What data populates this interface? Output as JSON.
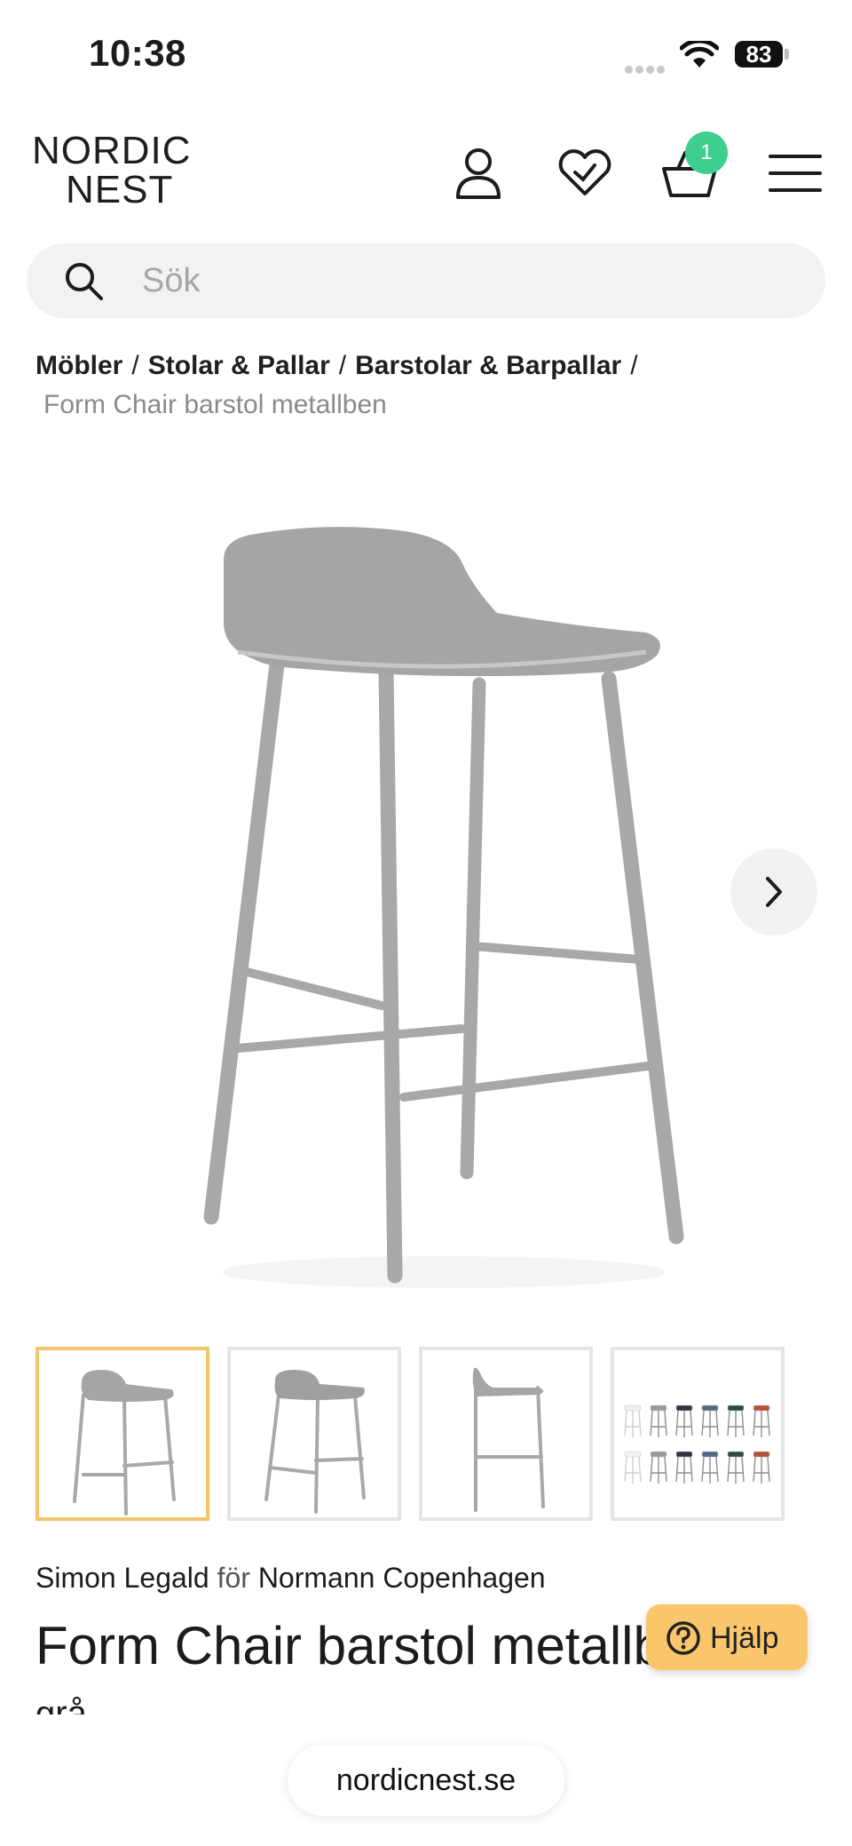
{
  "status_bar": {
    "time": "10:38",
    "battery": "83"
  },
  "header": {
    "logo_line1": "NORDIC",
    "logo_line2": "NEST",
    "cart_count": "1",
    "icons": [
      "account-icon",
      "wishlist-heart-icon",
      "basket-icon",
      "menu-icon"
    ]
  },
  "search": {
    "placeholder": "Sök",
    "value": ""
  },
  "breadcrumb": {
    "items": [
      "Möbler",
      "Stolar & Pallar",
      "Barstolar & Barpallar"
    ],
    "separator": "/",
    "current": "Form Chair barstol metallben"
  },
  "gallery": {
    "thumbnail_count": 4,
    "active_index": 0,
    "swatch_colors": [
      "#f0f0f0",
      "#9a9a9a",
      "#2f3440",
      "#4f6a86",
      "#2e4b3f",
      "#b4513b"
    ]
  },
  "product": {
    "designer": "Simon Legald",
    "for_word": "för",
    "brand": "Normann Copenhagen",
    "title": "Form Chair barstol metallben",
    "color": "grå"
  },
  "help": {
    "label": "Hjälp"
  },
  "browser": {
    "url": "nordicnest.se"
  },
  "colors": {
    "badge": "#3ecf8e",
    "help": "#f9c66b",
    "active_thumb": "#f2c46b",
    "chair": "#a8a8a8"
  }
}
